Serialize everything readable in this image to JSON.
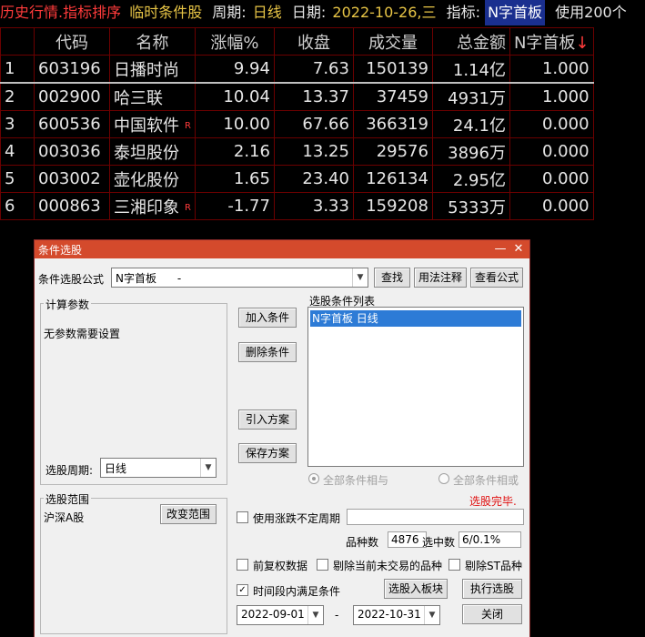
{
  "topbar": {
    "mode": "历史行情.指标排序",
    "condition": "临时条件股",
    "period_label": "周期:",
    "period_value": "日线",
    "date_label": "日期:",
    "date_value": "2022-10-26,三",
    "indicator_label": "指标:",
    "indicator_value": "N字首板",
    "usage": "使用200个"
  },
  "table": {
    "headers": [
      "",
      "代码",
      "名称",
      "涨幅%",
      "收盘",
      "成交量",
      "总金额",
      "N字首板"
    ],
    "sort_indicator": "↓",
    "rows": [
      {
        "idx": "1",
        "code": "603196",
        "name": "日播时尚",
        "flag": "",
        "pct": "9.94",
        "close": "7.63",
        "volume": "150139",
        "amount": "1.14亿",
        "n": "1.000"
      },
      {
        "idx": "2",
        "code": "002900",
        "name": "哈三联",
        "flag": "",
        "pct": "10.04",
        "close": "13.37",
        "volume": "37459",
        "amount": "4931万",
        "n": "1.000"
      },
      {
        "idx": "3",
        "code": "600536",
        "name": "中国软件",
        "flag": "R",
        "pct": "10.00",
        "close": "67.66",
        "volume": "366319",
        "amount": "24.1亿",
        "n": "0.000"
      },
      {
        "idx": "4",
        "code": "003036",
        "name": "泰坦股份",
        "flag": "",
        "pct": "2.16",
        "close": "13.25",
        "volume": "29576",
        "amount": "3896万",
        "n": "0.000"
      },
      {
        "idx": "5",
        "code": "003002",
        "name": "壶化股份",
        "flag": "",
        "pct": "1.65",
        "close": "23.40",
        "volume": "126134",
        "amount": "2.95亿",
        "n": "0.000"
      },
      {
        "idx": "6",
        "code": "000863",
        "name": "三湘印象",
        "flag": "R",
        "pct": "-1.77",
        "close": "3.33",
        "volume": "159208",
        "amount": "5333万",
        "n": "0.000"
      }
    ]
  },
  "colors": {
    "up": "#ff3b3b",
    "down": "#2fd4d4",
    "volume": "#e8d34a",
    "dialog_title": "#d44a2c",
    "selection": "#2d7bd6"
  },
  "dialog": {
    "title": "条件选股",
    "minimize": "—",
    "close": "✕",
    "formula_label": "条件选股公式",
    "formula_value": "N字首板      -",
    "find_button": "查找",
    "usage_note_button": "用法注释",
    "view_formula_button": "查看公式",
    "params_group": "计算参数",
    "params_text": "无参数需要设置",
    "period_label": "选股周期:",
    "period_value": "日线",
    "add_condition_button": "加入条件",
    "delete_condition_button": "删除条件",
    "import_plan_button": "引入方案",
    "save_plan_button": "保存方案",
    "list_label": "选股条件列表",
    "list_items": [
      "N字首板  日线"
    ],
    "radio_and": "全部条件相与",
    "radio_or": "全部条件相或",
    "status": "选股完毕.",
    "range_group": "选股范围",
    "range_value": "沪深A股",
    "change_range_button": "改变范围",
    "use_variable_period": "使用涨跌不定周期",
    "variety_count_label": "品种数",
    "variety_count": "4876",
    "selected_label": "选中数",
    "selected_value": "6/0.1%",
    "pre_adjust": "前复权数据",
    "exclude_untraded": "剔除当前未交易的品种",
    "exclude_st": "剔除ST品种",
    "time_range_check": "时间段内满足条件",
    "to_block_button": "选股入板块",
    "execute_button": "执行选股",
    "date_from": "2022-09-01",
    "date_sep": "-",
    "date_to": "2022-10-31",
    "close_button": "关闭"
  }
}
